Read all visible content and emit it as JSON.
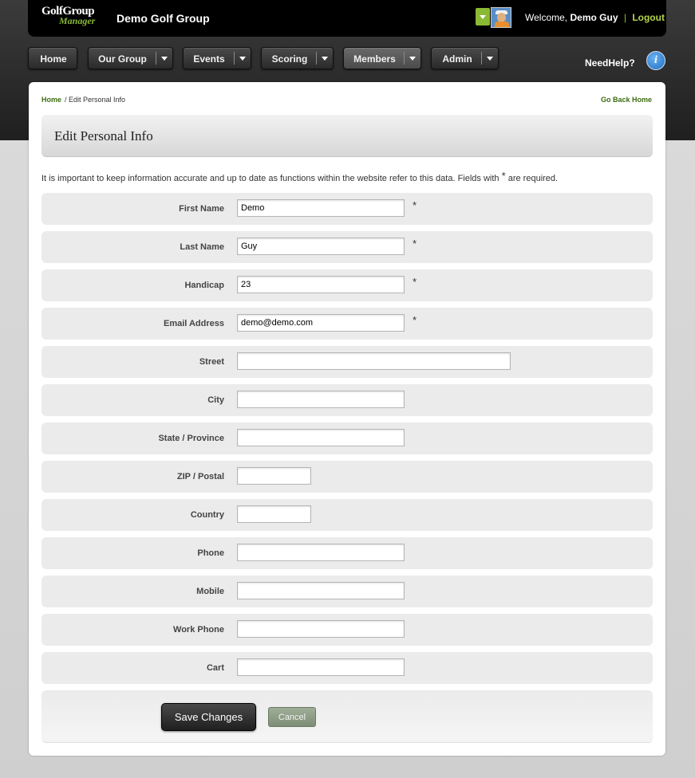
{
  "header": {
    "logo_text": "GolfGroup Manager",
    "site_title": "Demo Golf Group",
    "welcome_prefix": "Welcome,",
    "user_name": "Demo Guy",
    "separator": "|",
    "logout_label": "Logout"
  },
  "nav": {
    "items": [
      {
        "label": "Home"
      },
      {
        "label": "Our Group"
      },
      {
        "label": "Events"
      },
      {
        "label": "Scoring"
      },
      {
        "label": "Members"
      },
      {
        "label": "Admin"
      }
    ],
    "need_help_label": "NeedHelp?",
    "help_icon_glyph": "i"
  },
  "breadcrumb": {
    "home": "Home",
    "current": "/ Edit Personal Info",
    "go_back": "Go Back Home"
  },
  "page": {
    "title": "Edit Personal Info",
    "intro_before": "It is important to keep information accurate and up to date as functions within the website refer to this data. Fields with",
    "intro_star": "*",
    "intro_after": "are required."
  },
  "form": {
    "fields": [
      {
        "label": "First Name",
        "value": "Demo",
        "required_mark": "*"
      },
      {
        "label": "Last Name",
        "value": "Guy",
        "required_mark": "*"
      },
      {
        "label": "Handicap",
        "value": "23",
        "required_mark": "*"
      },
      {
        "label": "Email Address",
        "value": "demo@demo.com",
        "required_mark": "*"
      },
      {
        "label": "Street",
        "value": ""
      },
      {
        "label": "City",
        "value": ""
      },
      {
        "label": "State / Province",
        "value": ""
      },
      {
        "label": "ZIP / Postal",
        "value": ""
      },
      {
        "label": "Country",
        "value": ""
      },
      {
        "label": "Phone",
        "value": ""
      },
      {
        "label": "Mobile",
        "value": ""
      },
      {
        "label": "Work Phone",
        "value": ""
      },
      {
        "label": "Cart",
        "value": ""
      }
    ],
    "save_label": "Save Changes",
    "cancel_label": "Cancel"
  },
  "colors": {
    "accent_green": "#8ab934",
    "link_green": "#3d6b12",
    "help_blue": "#1f6fc0"
  }
}
